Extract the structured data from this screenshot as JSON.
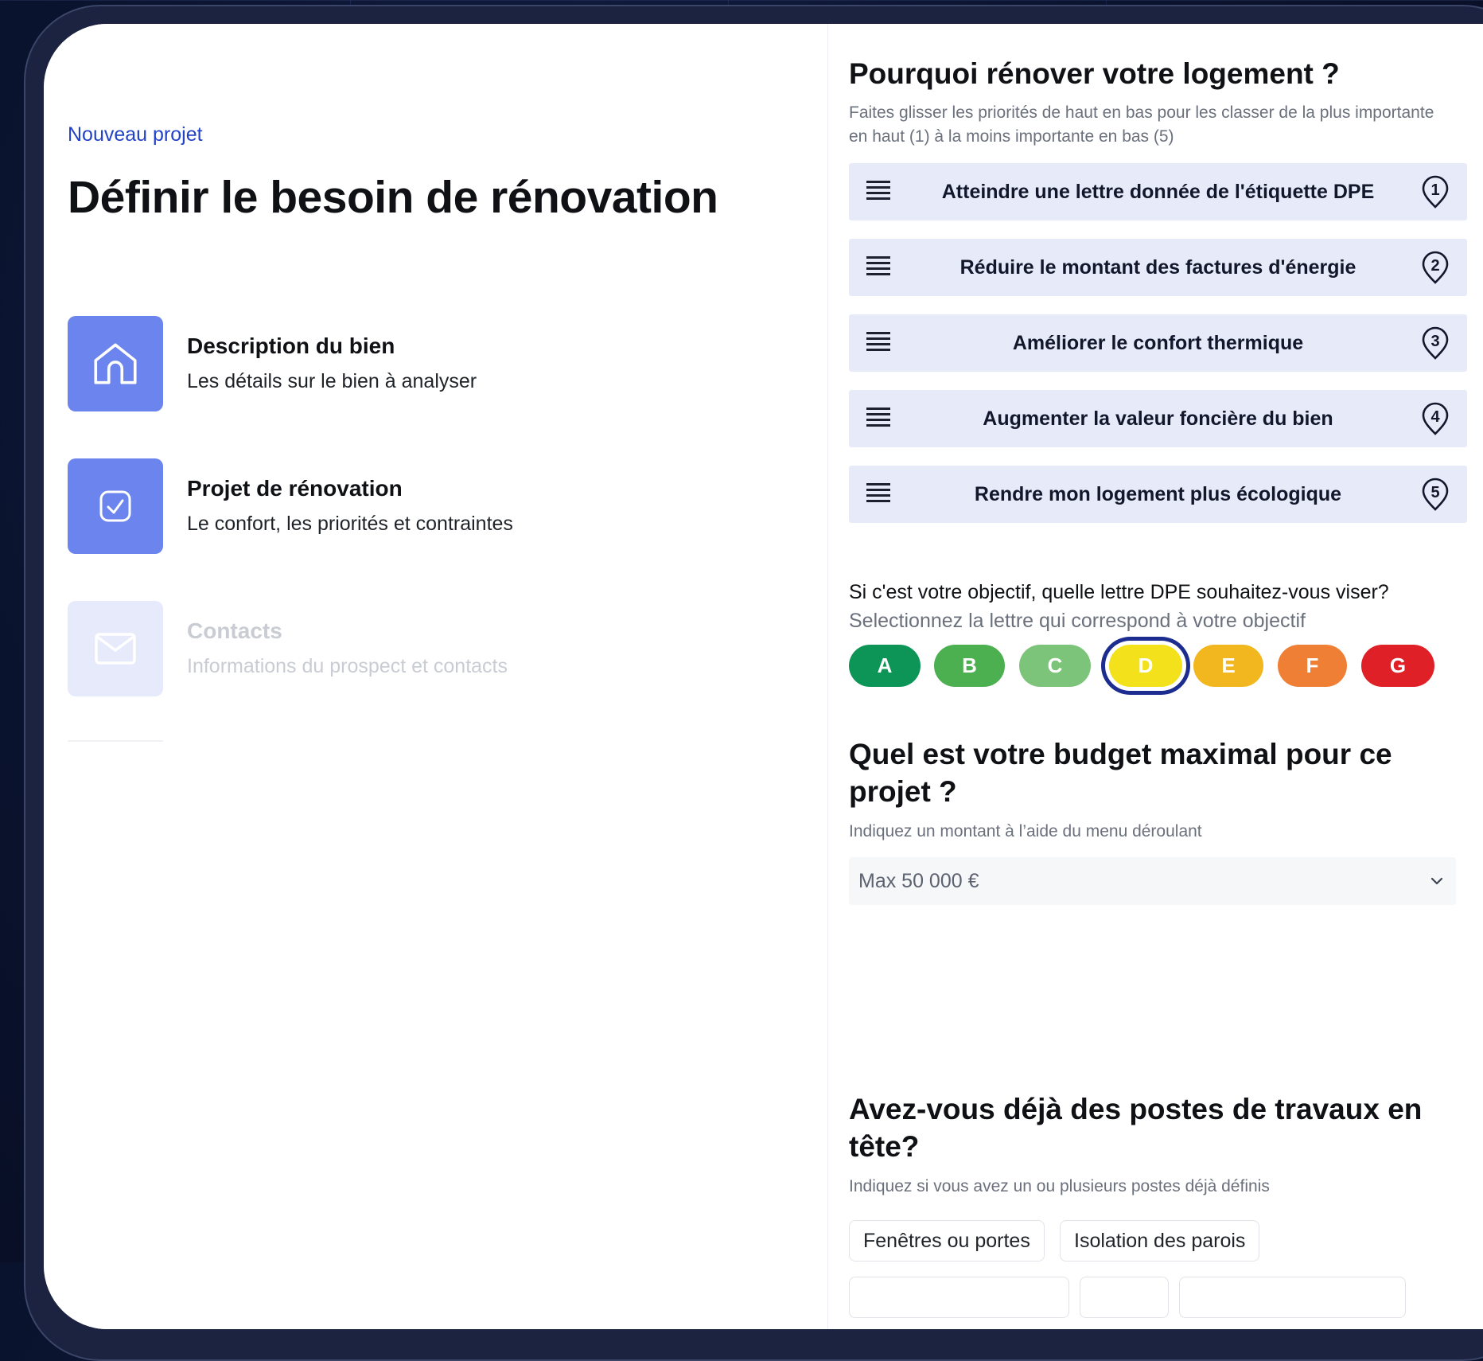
{
  "left": {
    "kicker": "Nouveau projet",
    "title": "Définir le besoin de rénovation",
    "steps": [
      {
        "title": "Description du bien",
        "subtitle": "Les détails sur le bien à analyser",
        "icon": "house-icon",
        "state": "done"
      },
      {
        "title": "Projet de rénovation",
        "subtitle": "Le confort, les priorités et contraintes",
        "icon": "check-square-icon",
        "state": "current"
      },
      {
        "title": "Contacts",
        "subtitle": "Informations du prospect et contacts",
        "icon": "mail-icon",
        "state": "upcoming"
      }
    ]
  },
  "priorities": {
    "title": "Pourquoi rénover votre logement ?",
    "help": "Faites glisser les priorités de haut en bas pour les classer de la plus importante en haut (1) à la moins importante en bas (5)",
    "items": [
      {
        "label": "Atteindre une lettre donnée de l'étiquette DPE",
        "rank": "1"
      },
      {
        "label": "Réduire le montant des factures d'énergie",
        "rank": "2"
      },
      {
        "label": "Améliorer le confort thermique",
        "rank": "3"
      },
      {
        "label": "Augmenter la valeur foncière du bien",
        "rank": "4"
      },
      {
        "label": "Rendre mon logement plus écologique",
        "rank": "5"
      }
    ]
  },
  "dpe": {
    "question": "Si c'est votre objectif, quelle lettre DPE souhaitez-vous viser?",
    "help": "Selectionnez la lettre qui correspond à votre objectif",
    "selected": "D",
    "letters": [
      {
        "label": "A",
        "color": "#0d9558"
      },
      {
        "label": "B",
        "color": "#4caf50"
      },
      {
        "label": "C",
        "color": "#7cc47a"
      },
      {
        "label": "D",
        "color": "#f3e11b"
      },
      {
        "label": "E",
        "color": "#f2b61e"
      },
      {
        "label": "F",
        "color": "#ef7f35"
      },
      {
        "label": "G",
        "color": "#df2027"
      }
    ]
  },
  "budget": {
    "title": "Quel est votre budget maximal pour ce projet ?",
    "help": "Indiquez un montant à l’aide du menu déroulant",
    "value": "Max 50 000 €"
  },
  "works": {
    "title": "Avez-vous déjà des postes de travaux en tête?",
    "help": "Indiquez si vous avez un ou plusieurs postes déjà définis",
    "chips": [
      "Fenêtres ou portes",
      "Isolation des parois"
    ]
  },
  "colors": {
    "accent": "#2242c7",
    "step_active": "#6c85ee",
    "priority_bg": "#e7ebf9",
    "dpe_selected_ring": "#1c2d8f"
  }
}
